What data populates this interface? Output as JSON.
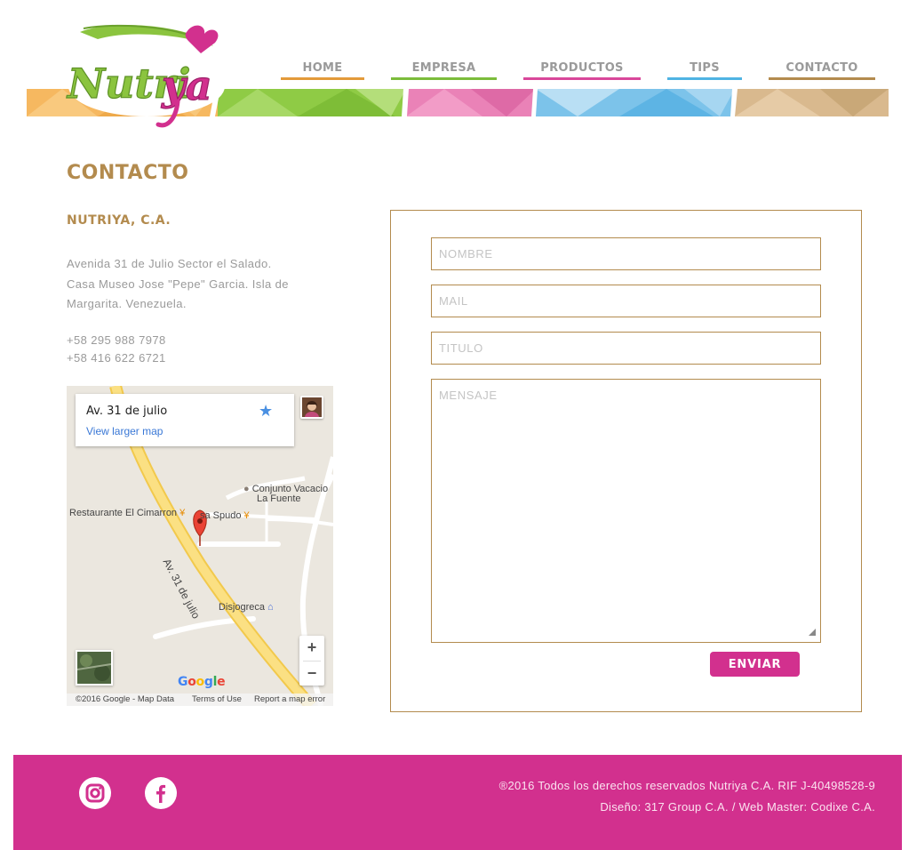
{
  "brand": {
    "logo_text": "Nutriya"
  },
  "nav": {
    "items": [
      {
        "label": "HOME",
        "color": "#e39a3a"
      },
      {
        "label": "EMPRESA",
        "color": "#7cbc3b"
      },
      {
        "label": "PRODUCTOS",
        "color": "#d9479a"
      },
      {
        "label": "TIPS",
        "color": "#4fb3e3"
      },
      {
        "label": "CONTACTO",
        "color": "#b38b4e"
      }
    ]
  },
  "page": {
    "title": "CONTACTO"
  },
  "contact": {
    "company": "NUTRIYA, C.A.",
    "address_line1": "Avenida 31 de Julio Sector el Salado.",
    "address_line2": "Casa Museo Jose \"Pepe\" Garcia. Isla de",
    "address_line3": "Margarita. Venezuela.",
    "phone1": "+58 295 988 7978",
    "phone2": "+58 416 622 6721"
  },
  "map": {
    "place_name": "Av. 31 de julio",
    "larger_link": "View larger map",
    "road_label": "Av. 31 de julio",
    "poi_conjunto_line1": "Conjunto Vacacio",
    "poi_conjunto_line2": "La Fuente",
    "poi_restaurante": "Restaurante El Cimarron",
    "poi_spudo": "sa Spudo",
    "poi_disjogreca": "Disjogreca",
    "google": "Google",
    "footer_data": "©2016 Google - Map Data",
    "footer_terms": "Terms of Use",
    "footer_report": "Report a map error"
  },
  "form": {
    "name_placeholder": "NOMBRE",
    "mail_placeholder": "MAIL",
    "title_placeholder": "TITULO",
    "message_placeholder": "MENSAJE",
    "submit_label": "ENVIAR"
  },
  "footer": {
    "copyright": "®2016 Todos los derechos reservados Nutriya C.A. RIF J-40498528-9",
    "credits": "Diseño: 317 Group C.A. / Web Master: Codixe C.A.",
    "social_icons": [
      "instagram-icon",
      "facebook-icon"
    ],
    "background": "#d2308e"
  },
  "colors": {
    "accent_gold": "#b38b4e",
    "accent_pink": "#d2308e"
  }
}
